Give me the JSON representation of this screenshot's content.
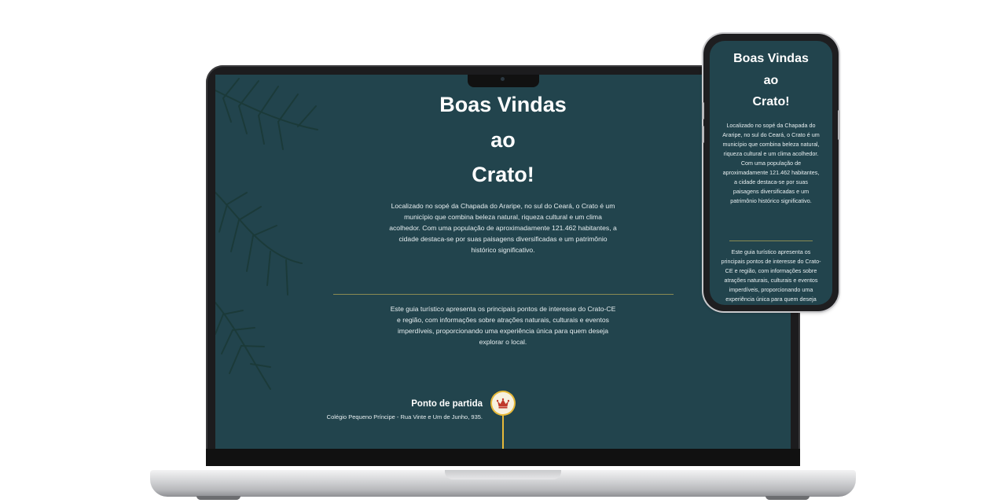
{
  "hero": {
    "title_line1": "Boas Vindas",
    "title_line2": "ao",
    "title_line3": "Crato!"
  },
  "laptop": {
    "intro_lines": [
      "Localizado no sopé da Chapada do Araripe, no sul do Ceará, o Crato é um",
      "município que combina beleza natural, riqueza cultural e um clima",
      "acolhedor. Com uma população de aproximadamente 121.462 habitantes, a",
      "cidade destaca-se por suas paisagens diversificadas e um patrimônio",
      "histórico significativo."
    ],
    "guide_lines": [
      "Este guia turístico apresenta os principais pontos de interesse do Crato-CE",
      "e região, com informações sobre atrações naturais, culturais e eventos",
      "imperdíveis, proporcionando uma experiência única para quem deseja",
      "explorar o local."
    ]
  },
  "phone": {
    "intro_lines": [
      "Localizado no sopé da Chapada do",
      "Araripe, no sul do Ceará, o Crato é um",
      "município que combina beleza natural,",
      "riqueza cultural e um clima acolhedor.",
      "Com uma população de",
      "aproximadamente 121.462 habitantes,",
      "a cidade destaca-se por suas",
      "paisagens diversificadas e um",
      "patrimônio histórico significativo."
    ],
    "guide_lines": [
      "Este guia turístico apresenta os",
      "principais pontos de interesse do Crato-",
      "CE e região, com informações sobre",
      "atrações naturais, culturais e eventos",
      "imperdíveis, proporcionando uma",
      "experiência única para quem deseja"
    ]
  },
  "timeline": {
    "start_title": "Ponto de partida",
    "start_address": "Colégio Pequeno Príncipe - Rua Vinte e Um de Junho, 935."
  },
  "colors": {
    "background": "#22444d",
    "accent_gold": "#e6b93a",
    "divider": "#8a8a52",
    "crown_red": "#c0392b"
  },
  "icons": {
    "marker": "crown-icon"
  }
}
